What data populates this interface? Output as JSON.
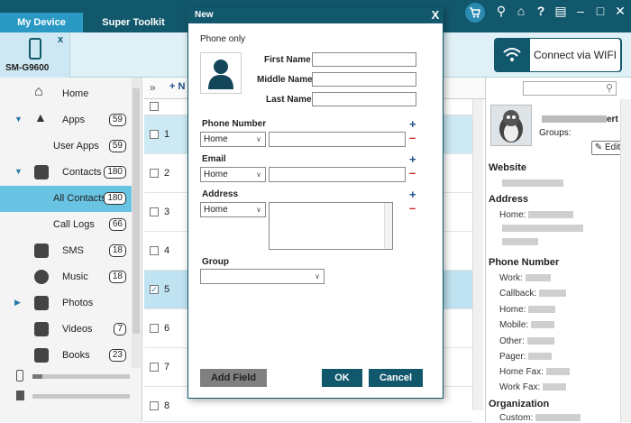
{
  "top_tabs": [
    "My Device",
    "Super Toolkit"
  ],
  "toolbar_icons": [
    "cart-icon",
    "key-icon",
    "home-icon",
    "help-icon",
    "feedback-icon",
    "minimize-icon",
    "maximize-icon",
    "close-icon"
  ],
  "device": {
    "name": "SM-G9600",
    "close": "x"
  },
  "connect_wifi": "Connect via WIFI",
  "sidebar": {
    "items": [
      {
        "label": "Home",
        "icon": "home-icon"
      },
      {
        "label": "Apps",
        "count": "59",
        "icon": "apps-icon"
      },
      {
        "label": "User Apps",
        "count": "59"
      },
      {
        "label": "Contacts",
        "count": "180",
        "icon": "contacts-icon"
      },
      {
        "label": "All Contacts",
        "count": "180"
      },
      {
        "label": "Call Logs",
        "count": "66"
      },
      {
        "label": "SMS",
        "count": "18",
        "icon": "sms-icon"
      },
      {
        "label": "Music",
        "count": "18",
        "icon": "music-icon"
      },
      {
        "label": "Photos",
        "icon": "photos-icon"
      },
      {
        "label": "Videos",
        "count": "7",
        "icon": "videos-icon"
      },
      {
        "label": "Books",
        "count": "23",
        "icon": "books-icon"
      }
    ]
  },
  "list": {
    "toolbar_new": "N",
    "rows": [
      "1",
      "2",
      "3",
      "4",
      "5",
      "6",
      "7",
      "8"
    ]
  },
  "detail": {
    "groups_label": "Groups:",
    "edit": "Edit",
    "name_suffix": "ert",
    "website": "Website",
    "address": "Address",
    "home_addr": "Home:",
    "phone_number": "Phone Number",
    "phones": [
      "Work:",
      "Callback:",
      "Home:",
      "Mobile:",
      "Other:",
      "Pager:",
      "Home Fax:",
      "Work Fax:"
    ],
    "organization": "Organization",
    "custom": "Custom:"
  },
  "dialog": {
    "title": "New",
    "close": "X",
    "phone_only": "Phone only",
    "first_name": "First Name",
    "middle_name": "Middle Name",
    "last_name": "Last Name",
    "phone_number": "Phone Number",
    "phone_type": "Home",
    "email": "Email",
    "email_type": "Home",
    "address": "Address",
    "address_type": "Home",
    "group": "Group",
    "add_field": "Add Field",
    "ok": "OK",
    "cancel": "Cancel"
  }
}
